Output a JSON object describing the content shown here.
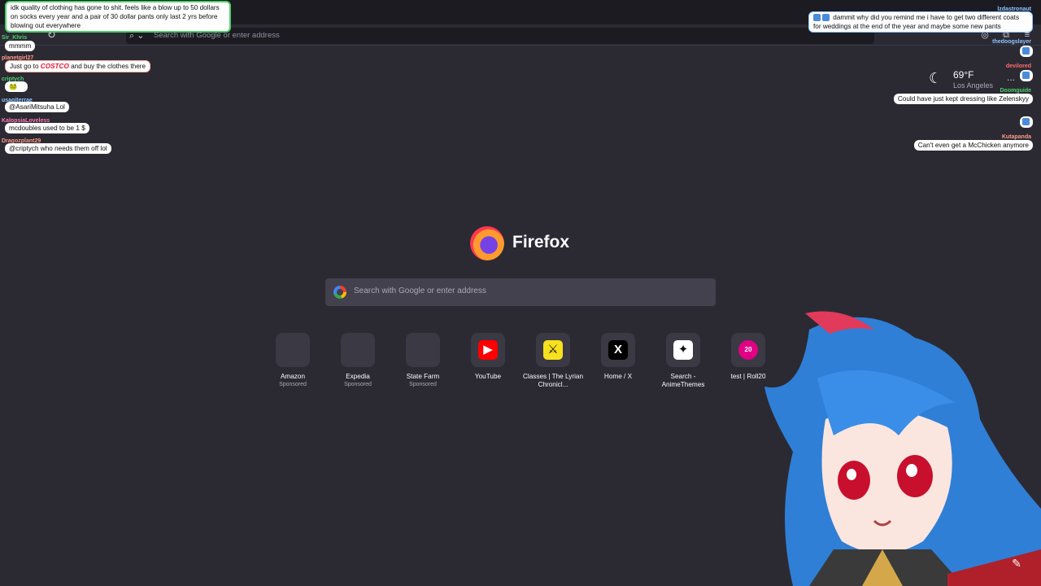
{
  "browser": {
    "reload_icon": "reload-icon",
    "url_placeholder": "Search with Google or enter address"
  },
  "weather": {
    "temp": "69°F",
    "city": "Los Angeles",
    "more": "..."
  },
  "logo": {
    "wordmark": "Firefox"
  },
  "search": {
    "placeholder": "Search with Google or enter address"
  },
  "top_sites": [
    {
      "title": "Amazon",
      "sponsored": "Sponsored",
      "icon": "",
      "bg": "#3a3944"
    },
    {
      "title": "Expedia",
      "sponsored": "Sponsored",
      "icon": "",
      "bg": "#3a3944"
    },
    {
      "title": "State Farm",
      "sponsored": "Sponsored",
      "icon": "",
      "bg": "#3a3944"
    },
    {
      "title": "YouTube",
      "sponsored": "",
      "icon": "▶",
      "bg": "#ff0000"
    },
    {
      "title": "Classes | The Lyrian Chronicl...",
      "sponsored": "",
      "icon": "⚔",
      "bg": "#f7e11e"
    },
    {
      "title": "Home / X",
      "sponsored": "",
      "icon": "X",
      "bg": "#000000"
    },
    {
      "title": "Search - AnimeThemes",
      "sponsored": "",
      "icon": "✦",
      "bg": "#ffffff"
    },
    {
      "title": "test | Roll20",
      "sponsored": "",
      "icon": "20",
      "bg": "#e10085"
    }
  ],
  "chat_left": [
    {
      "user": "",
      "text": "idk quality of clothing has gone to shit. feels like a blow up to 50 dollars on socks every year and a pair of 30 dollar pants only last 2 yrs before blowing out everywhere"
    },
    {
      "user": "Sir_Khris",
      "text": "mmmm"
    },
    {
      "user": "planetgirl27",
      "text_before": "Just go to",
      "brand": "COSTCO",
      "text_after": "and buy the clothes there"
    },
    {
      "user": "criptych",
      "text": ""
    },
    {
      "user": "usagiterrae",
      "text": "@AsariMitsuha Lol"
    },
    {
      "user": "KalopsiaLoveless",
      "text": "mcdoubles used to be 1 $"
    },
    {
      "user": "Dragozplant29",
      "text": "@criptych who needs them off lol"
    }
  ],
  "chat_right": [
    {
      "user": "lzdastronaut",
      "text": "dammit why did you remind me i have to get two different coats for weddings at the end of the year and maybe some new pants"
    },
    {
      "user": "thedoogslayer",
      "text": ""
    },
    {
      "user": "devilored",
      "text": ""
    },
    {
      "user": "Doomguide",
      "text": "Could have just kept dressing like Zelenskyy"
    },
    {
      "user": "",
      "text": ""
    },
    {
      "user": "Kutapanda",
      "text": "Can't even get a McChicken anymore"
    }
  ],
  "edit_icon": "pencil-icon"
}
